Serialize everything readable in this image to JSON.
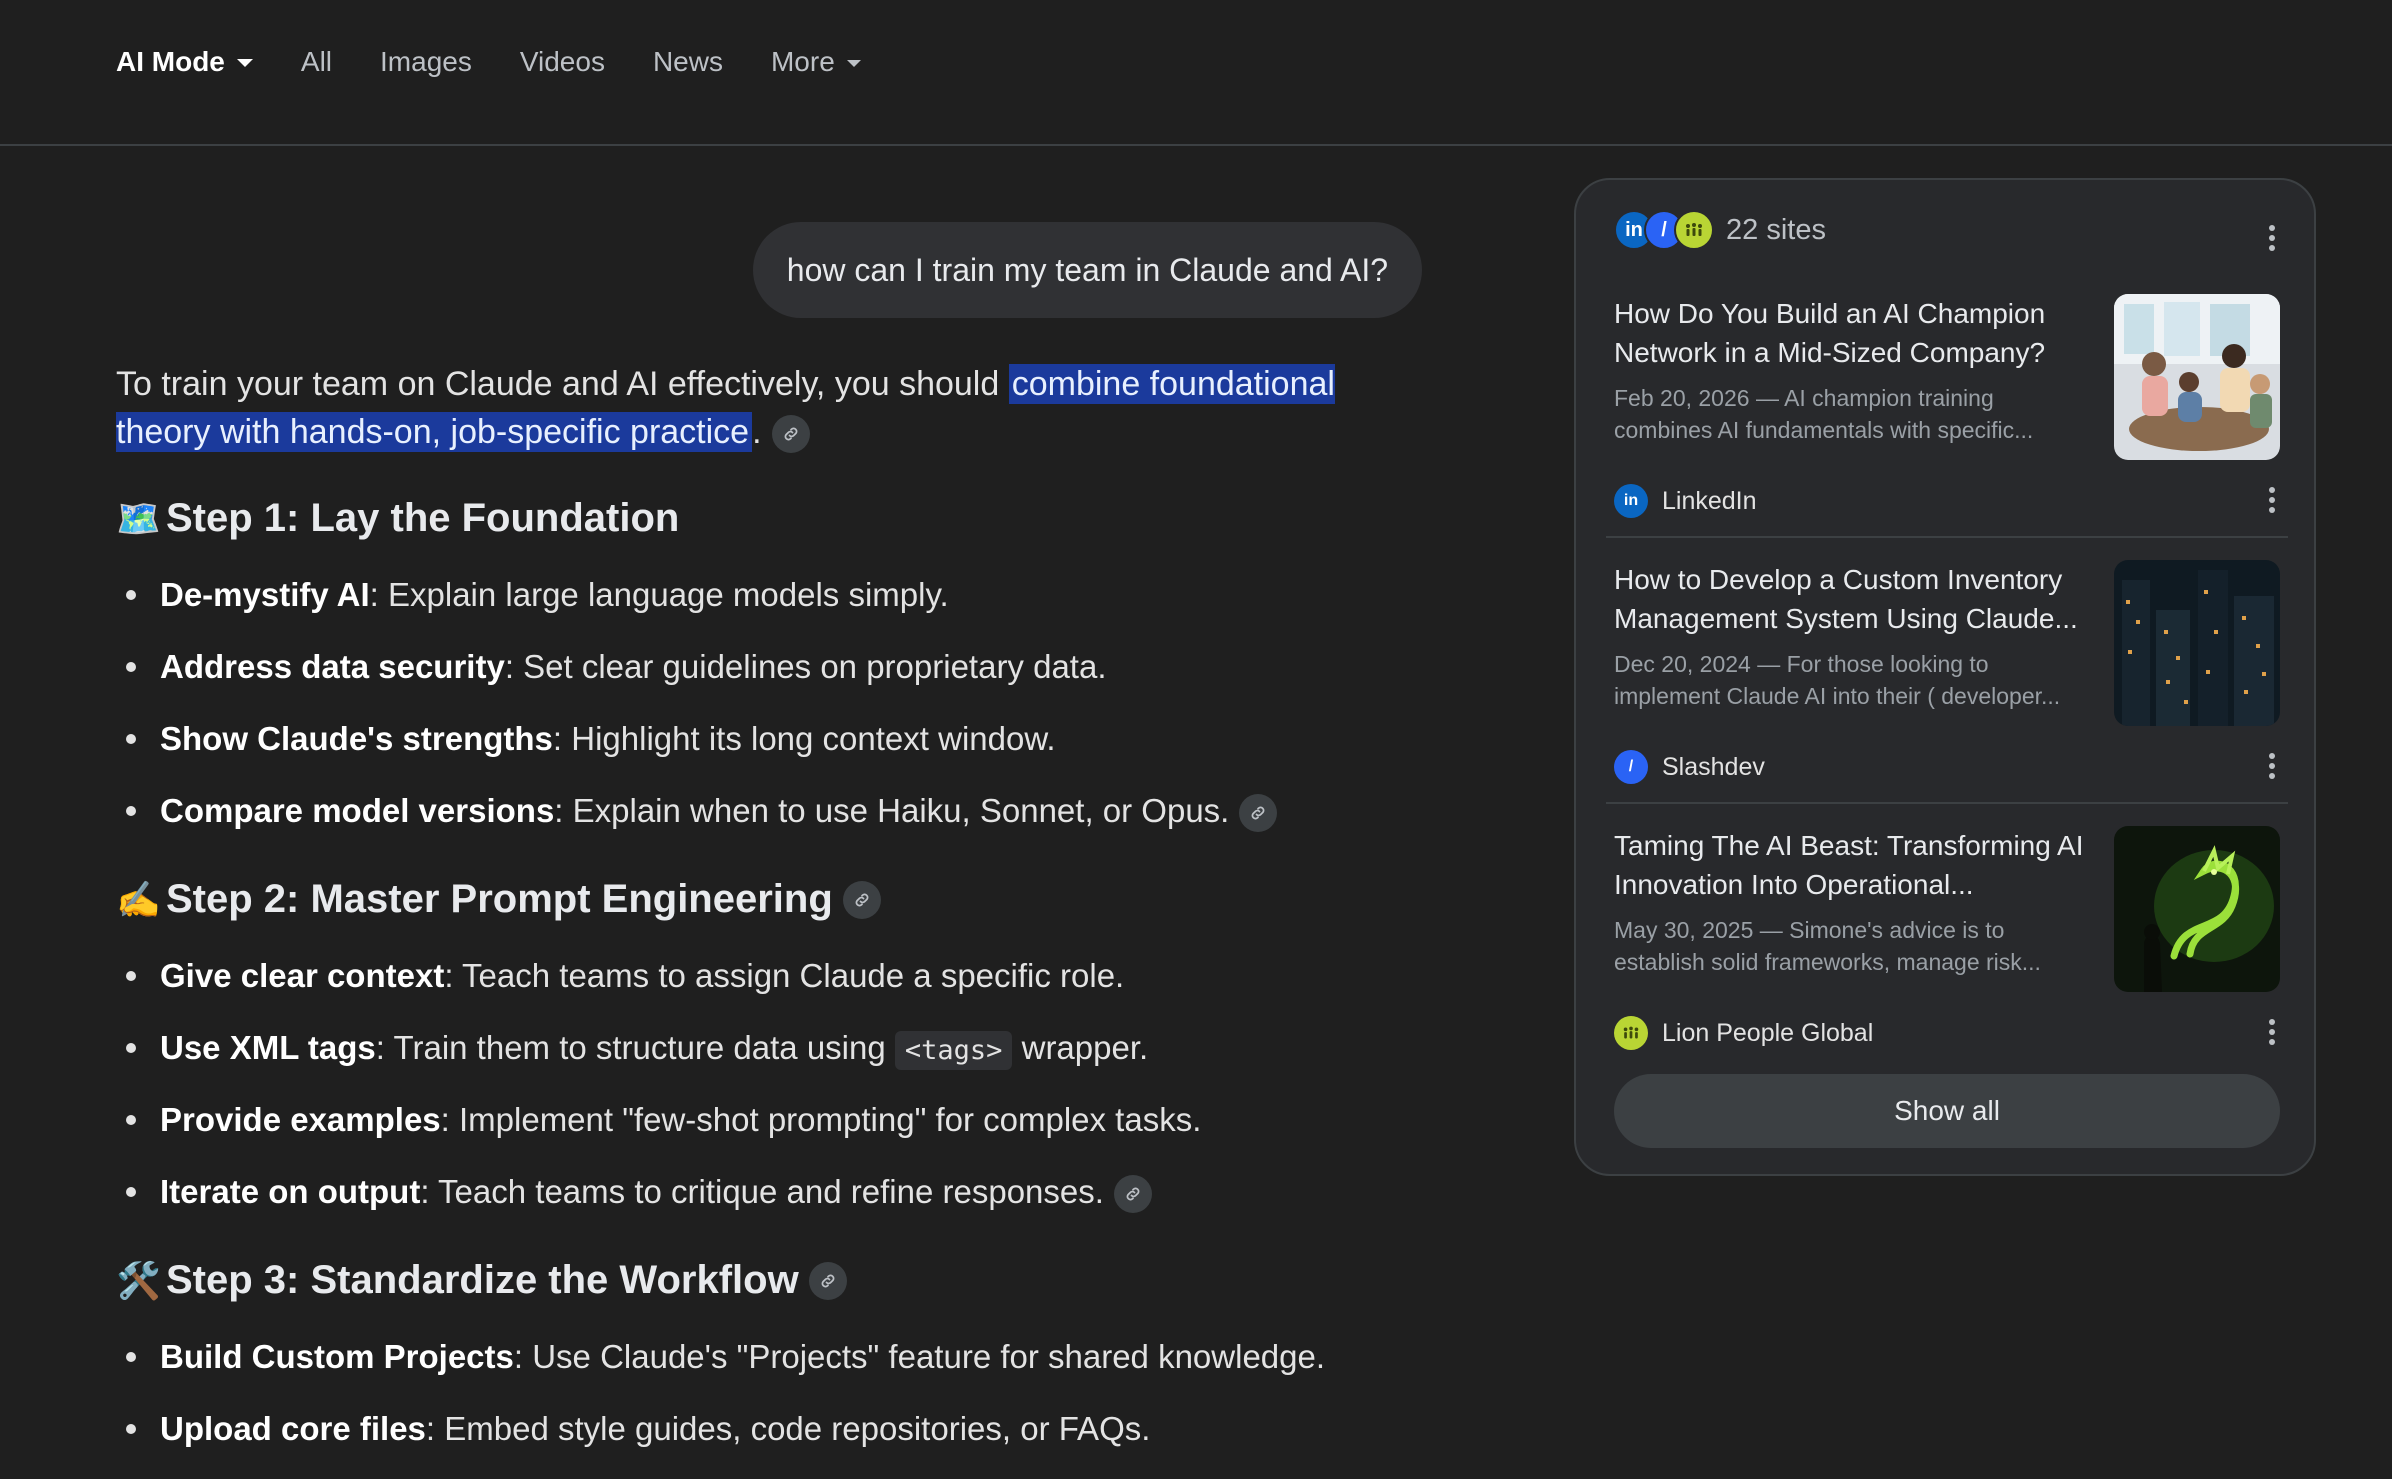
{
  "nav": {
    "tabs": [
      {
        "label": "AI Mode",
        "active": true,
        "dropdown": true
      },
      {
        "label": "All"
      },
      {
        "label": "Images"
      },
      {
        "label": "Videos"
      },
      {
        "label": "News"
      },
      {
        "label": "More",
        "dropdown": true
      }
    ]
  },
  "query": "how can I train my team in Claude and AI?",
  "answer": {
    "intro_before": "To train your team on Claude and AI effectively, you should ",
    "intro_highlight": "combine foundational theory with hands-on, job-specific practice",
    "intro_after": ".",
    "steps": [
      {
        "emoji": "🗺️",
        "title": "Step 1: Lay the Foundation",
        "items": [
          {
            "bold": "De-mystify AI",
            "text": ": Explain large language models simply."
          },
          {
            "bold": "Address data security",
            "text": ": Set clear guidelines on proprietary data."
          },
          {
            "bold": "Show Claude's strengths",
            "text": ": Highlight its long context window."
          },
          {
            "bold": "Compare model versions",
            "text": ": Explain when to use Haiku, Sonnet, or Opus."
          }
        ]
      },
      {
        "emoji": "✍️",
        "title": "Step 2: Master Prompt Engineering",
        "items": [
          {
            "bold": "Give clear context",
            "text": ": Teach teams to assign Claude a specific role."
          },
          {
            "bold": "Use XML tags",
            "text_before": ": Train them to structure data using ",
            "code": "<tags>",
            "text_after": " wrapper."
          },
          {
            "bold": "Provide examples",
            "text": ": Implement \"few-shot prompting\" for complex tasks."
          },
          {
            "bold": "Iterate on output",
            "text": ": Teach teams to critique and refine responses."
          }
        ]
      },
      {
        "emoji": "🛠️",
        "title": "Step 3: Standardize the Workflow",
        "items": [
          {
            "bold": "Build Custom Projects",
            "text": ": Use Claude's \"Projects\" feature for shared knowledge."
          },
          {
            "bold": "Upload core files",
            "text": ": Embed style guides, code repositories, or FAQs."
          }
        ]
      }
    ]
  },
  "sources": {
    "count_label": "22 sites",
    "items": [
      {
        "title": "How Do You Build an AI Champion Network in a Mid-Sized Company?",
        "snippet": "Feb 20, 2026 — AI champion training combines AI fundamentals with specific...",
        "site": "LinkedIn",
        "favicon": "in"
      },
      {
        "title": "How to Develop a Custom Inventory Management System Using Claude...",
        "snippet": "Dec 20, 2024 — For those looking to implement Claude AI into their ( developer...",
        "site": "Slashdev",
        "favicon": "/"
      },
      {
        "title": "Taming The AI Beast: Transforming AI Innovation Into Operational...",
        "snippet": "May 30, 2025 — Simone's advice is to establish solid frameworks, manage risk...",
        "site": "Lion People Global",
        "favicon": "lp"
      }
    ],
    "show_all_label": "Show all"
  },
  "colors": {
    "background": "#1f1f1f",
    "highlight": "#1b3a9c",
    "panel": "#28292c",
    "linkedin": "#0a66c2",
    "slashdev": "#2a63f5",
    "lion_people": "#b9d534"
  }
}
